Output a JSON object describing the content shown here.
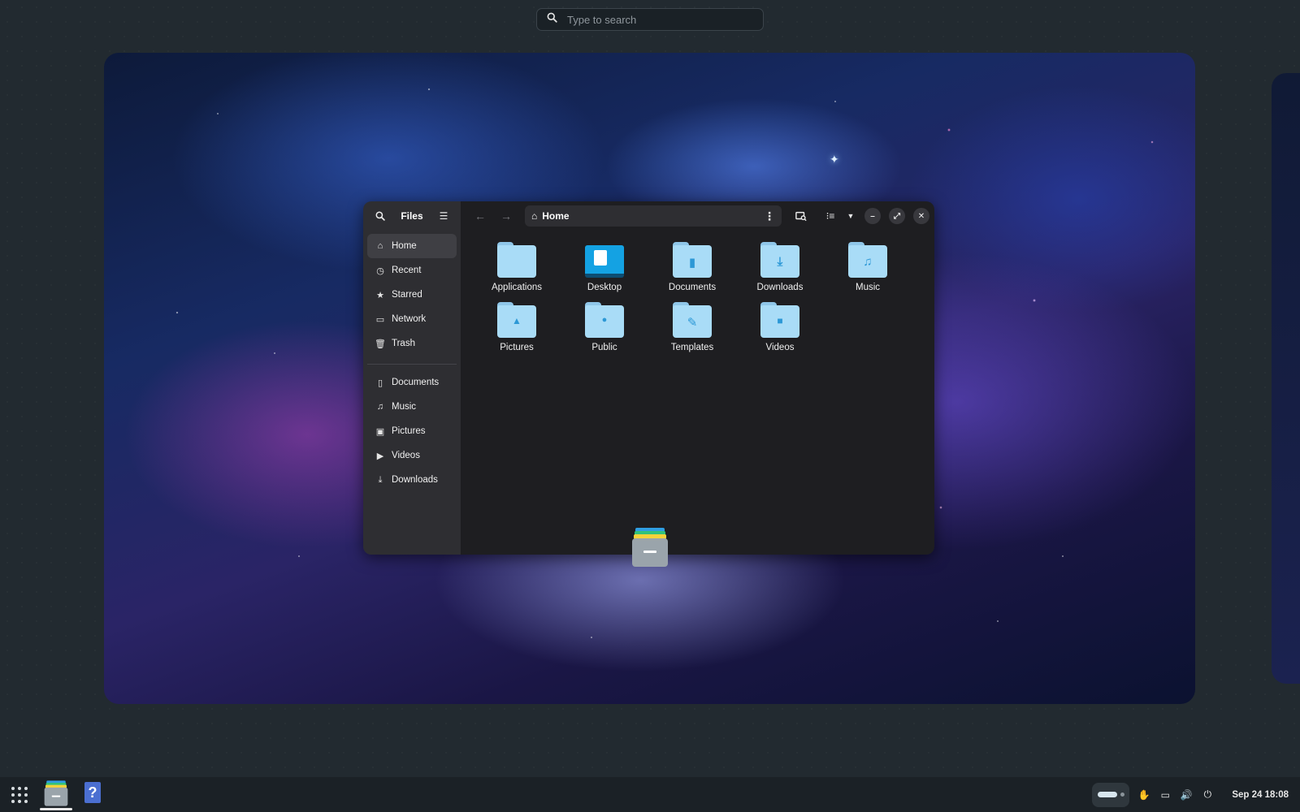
{
  "search": {
    "placeholder": "Type to search"
  },
  "files_window": {
    "title": "Files",
    "sidebar": {
      "places": [
        {
          "label": "Home",
          "icon": "home-icon",
          "active": true
        },
        {
          "label": "Recent",
          "icon": "clock-icon"
        },
        {
          "label": "Starred",
          "icon": "star-icon"
        },
        {
          "label": "Network",
          "icon": "network-icon"
        },
        {
          "label": "Trash",
          "icon": "trash-icon"
        }
      ],
      "bookmarks": [
        {
          "label": "Documents",
          "icon": "document-icon"
        },
        {
          "label": "Music",
          "icon": "music-icon"
        },
        {
          "label": "Pictures",
          "icon": "picture-icon"
        },
        {
          "label": "Videos",
          "icon": "video-icon"
        },
        {
          "label": "Downloads",
          "icon": "download-icon"
        }
      ]
    },
    "path": {
      "label": "Home"
    },
    "items": [
      {
        "label": "Applications",
        "emblem": ""
      },
      {
        "label": "Desktop",
        "emblem": "desktop"
      },
      {
        "label": "Documents",
        "emblem": "▮"
      },
      {
        "label": "Downloads",
        "emblem": "⤓"
      },
      {
        "label": "Music",
        "emblem": "♫"
      },
      {
        "label": "Pictures",
        "emblem": "▲"
      },
      {
        "label": "Public",
        "emblem": "●"
      },
      {
        "label": "Templates",
        "emblem": "✎"
      },
      {
        "label": "Videos",
        "emblem": "■"
      }
    ]
  },
  "panel": {
    "clock": "Sep 24  18:08"
  },
  "colors": {
    "accent": "#14a2e3",
    "folder": "#a9dcf7",
    "window_bg": "#1e1e21",
    "sidebar_bg": "#2e2e32"
  }
}
